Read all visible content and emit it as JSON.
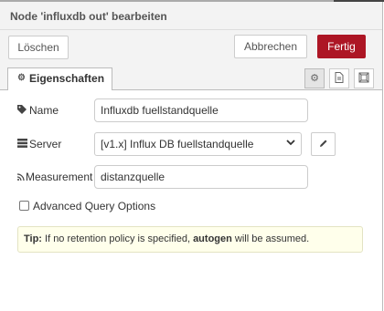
{
  "header": {
    "title": "Node 'influxdb out' bearbeiten"
  },
  "toolbar": {
    "delete_label": "Löschen",
    "cancel_label": "Abbrechen",
    "done_label": "Fertig",
    "done_color": "#ad1625"
  },
  "tabs": {
    "properties_label": "Eigenschaften",
    "properties_icon": "gear-icon",
    "side_icons": [
      "gear-icon",
      "document-icon",
      "frame-icon"
    ]
  },
  "form": {
    "name": {
      "label": "Name",
      "icon": "tag-icon",
      "value": "Influxdb fuellstandquelle"
    },
    "server": {
      "label": "Server",
      "icon": "server-icon",
      "value": "[v1.x] Influx DB fuellstandquelle",
      "edit_icon": "pencil-icon"
    },
    "measurement": {
      "label": "Measurement",
      "icon": "rss-icon",
      "value": "distanzquelle"
    },
    "advanced": {
      "label": "Advanced Query Options",
      "checked": false
    }
  },
  "tip": {
    "prefix": "Tip:",
    "text_before": " If no retention policy is specified, ",
    "highlight": "autogen",
    "text_after": " will be assumed."
  }
}
